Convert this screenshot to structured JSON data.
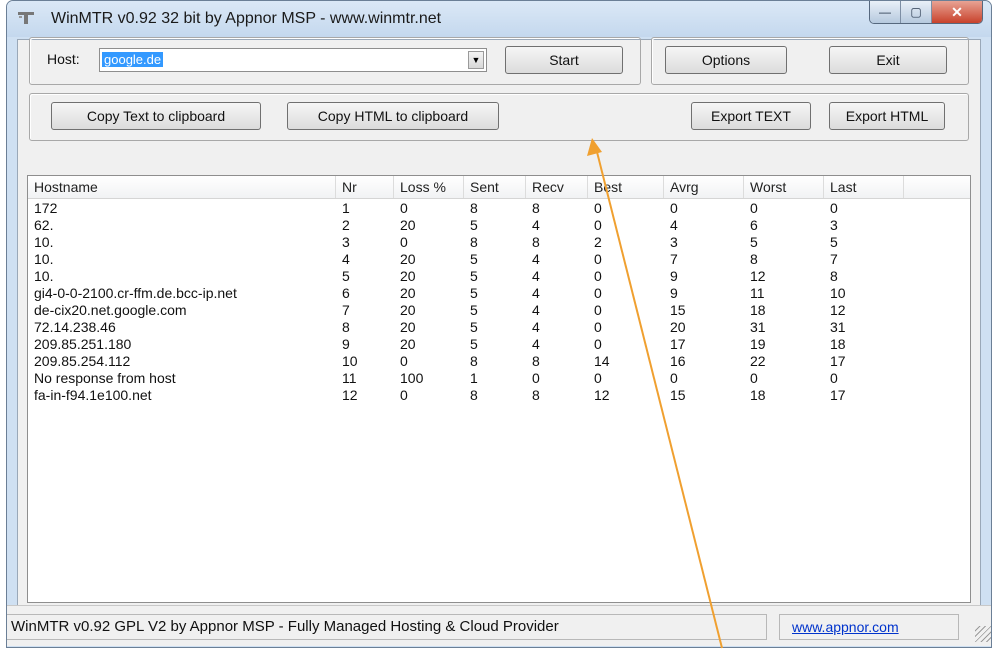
{
  "window": {
    "title": "WinMTR v0.92 32 bit by Appnor MSP - www.winmtr.net",
    "minimize": "—",
    "maximize": "▢",
    "close": "✕",
    "app_icon": "winmtr-app-icon"
  },
  "host": {
    "label": "Host:",
    "value": "google.de"
  },
  "buttons": {
    "start": "Start",
    "options": "Options",
    "exit": "Exit",
    "copy_text": "Copy Text to clipboard",
    "copy_html": "Copy HTML to clipboard",
    "export_text": "Export TEXT",
    "export_html": "Export HTML"
  },
  "table": {
    "columns": [
      "Hostname",
      "Nr",
      "Loss %",
      "Sent",
      "Recv",
      "Best",
      "Avrg",
      "Worst",
      "Last"
    ],
    "rows": [
      [
        "172",
        "1",
        "0",
        "8",
        "8",
        "0",
        "0",
        "0",
        "0"
      ],
      [
        "62.",
        "2",
        "20",
        "5",
        "4",
        "0",
        "4",
        "6",
        "3"
      ],
      [
        "10.",
        "3",
        "0",
        "8",
        "8",
        "2",
        "3",
        "5",
        "5"
      ],
      [
        "10.",
        "4",
        "20",
        "5",
        "4",
        "0",
        "7",
        "8",
        "7"
      ],
      [
        "10.",
        "5",
        "20",
        "5",
        "4",
        "0",
        "9",
        "12",
        "8"
      ],
      [
        "gi4-0-0-2100.cr-ffm.de.bcc-ip.net",
        "6",
        "20",
        "5",
        "4",
        "0",
        "9",
        "11",
        "10"
      ],
      [
        "de-cix20.net.google.com",
        "7",
        "20",
        "5",
        "4",
        "0",
        "15",
        "18",
        "12"
      ],
      [
        "72.14.238.46",
        "8",
        "20",
        "5",
        "4",
        "0",
        "20",
        "31",
        "31"
      ],
      [
        "209.85.251.180",
        "9",
        "20",
        "5",
        "4",
        "0",
        "17",
        "19",
        "18"
      ],
      [
        "209.85.254.112",
        "10",
        "0",
        "8",
        "8",
        "14",
        "16",
        "22",
        "17"
      ],
      [
        "No response from host",
        "11",
        "100",
        "1",
        "0",
        "0",
        "0",
        "0",
        "0"
      ],
      [
        "fa-in-f94.1e100.net",
        "12",
        "0",
        "8",
        "8",
        "12",
        "15",
        "18",
        "17"
      ]
    ]
  },
  "statusbar": {
    "text": "WinMTR v0.92 GPL V2 by Appnor MSP - Fully Managed Hosting & Cloud Provider",
    "link": "www.appnor.com"
  },
  "annotation": {
    "arrow_color": "#f0a030",
    "icon": "annotation-arrow"
  }
}
